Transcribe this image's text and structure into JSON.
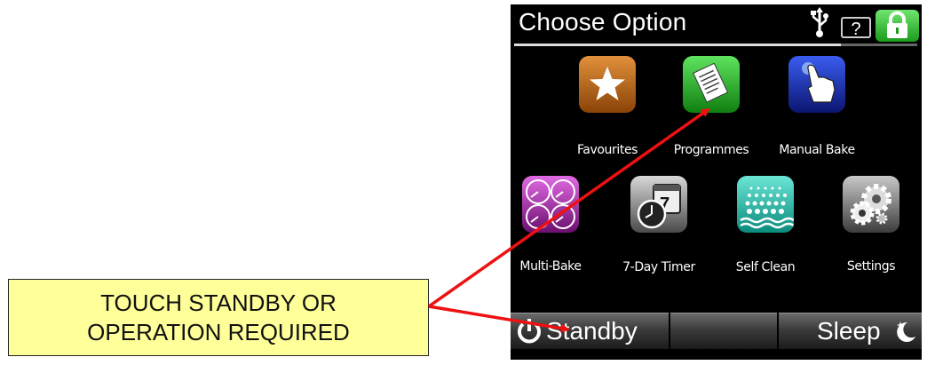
{
  "callout": {
    "line1": "TOUCH STANDBY OR",
    "line2": "OPERATION REQUIRED"
  },
  "screen": {
    "title": "Choose Option",
    "help_label": "?",
    "icons": {
      "usb": "usb-icon",
      "help": "question-icon",
      "lock": "lock-icon"
    },
    "tiles": [
      {
        "label": "Favourites",
        "icon": "star-icon",
        "color": "#b45e14"
      },
      {
        "label": "Programmes",
        "icon": "document-icon",
        "color": "#1ea21e"
      },
      {
        "label": "Manual Bake",
        "icon": "hand-pointer-icon",
        "color": "#1b2fb0"
      },
      {
        "label": "Multi-Bake",
        "icon": "multi-gauge-icon",
        "color": "#b235b5"
      },
      {
        "label": "7-Day Timer",
        "icon": "calendar-clock-icon",
        "color": "#777777"
      },
      {
        "label": "Self Clean",
        "icon": "water-icon",
        "color": "#14b0a0"
      },
      {
        "label": "Settings",
        "icon": "gears-icon",
        "color": "#666666"
      }
    ],
    "bottom_bar": {
      "standby_label": "Standby",
      "sleep_label": "Sleep"
    }
  },
  "colors": {
    "callout_bg": "#ffff99",
    "arrow": "#ee1111",
    "lock_green": "#2fbf2f"
  }
}
